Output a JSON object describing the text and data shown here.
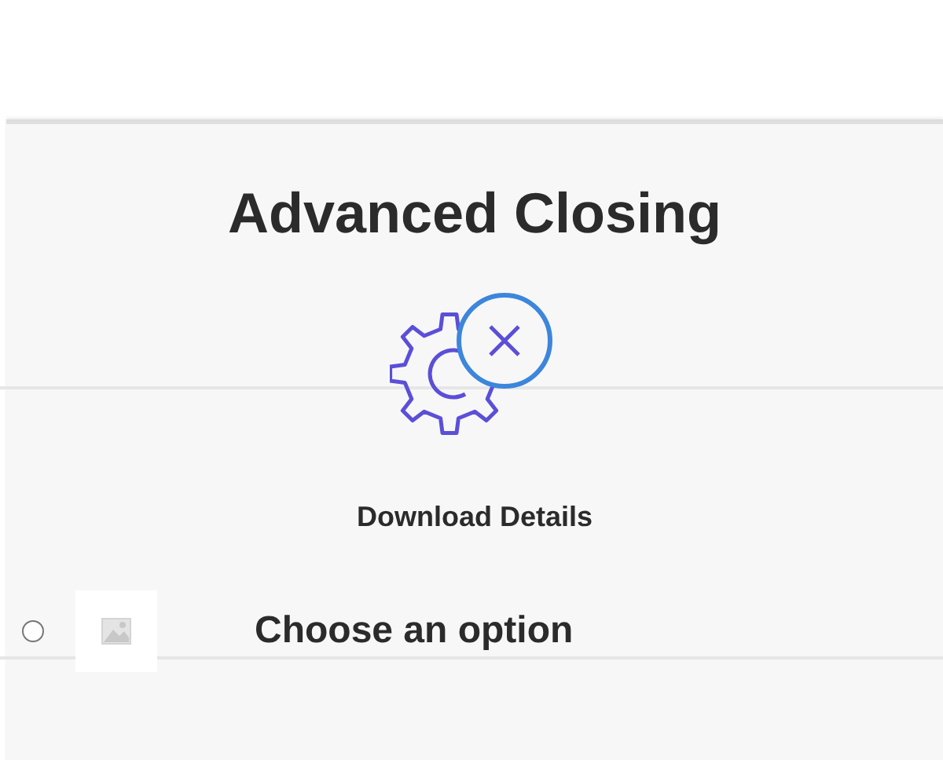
{
  "title": "Advanced Closing",
  "action": {
    "label": "Download Details"
  },
  "options": [
    {
      "label": "Choose an option",
      "selected": false
    }
  ]
}
